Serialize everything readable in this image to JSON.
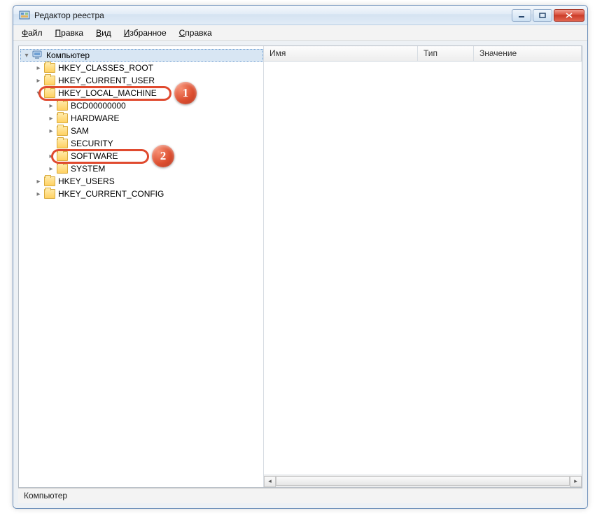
{
  "window": {
    "title": "Редактор реестра"
  },
  "menu": {
    "file": "Файл",
    "edit": "Правка",
    "view": "Вид",
    "favorites": "Избранное",
    "help": "Справка"
  },
  "columns": {
    "name": "Имя",
    "type": "Тип",
    "value": "Значение"
  },
  "tree": {
    "root": "Компьютер",
    "hkcr": "HKEY_CLASSES_ROOT",
    "hkcu": "HKEY_CURRENT_USER",
    "hklm": "HKEY_LOCAL_MACHINE",
    "hklm_children": {
      "bcd": "BCD00000000",
      "hardware": "HARDWARE",
      "sam": "SAM",
      "security": "SECURITY",
      "software": "SOFTWARE",
      "system": "SYSTEM"
    },
    "hku": "HKEY_USERS",
    "hkcc": "HKEY_CURRENT_CONFIG"
  },
  "statusbar": {
    "path": "Компьютер"
  },
  "annotations": {
    "marker1": "1",
    "marker2": "2"
  }
}
